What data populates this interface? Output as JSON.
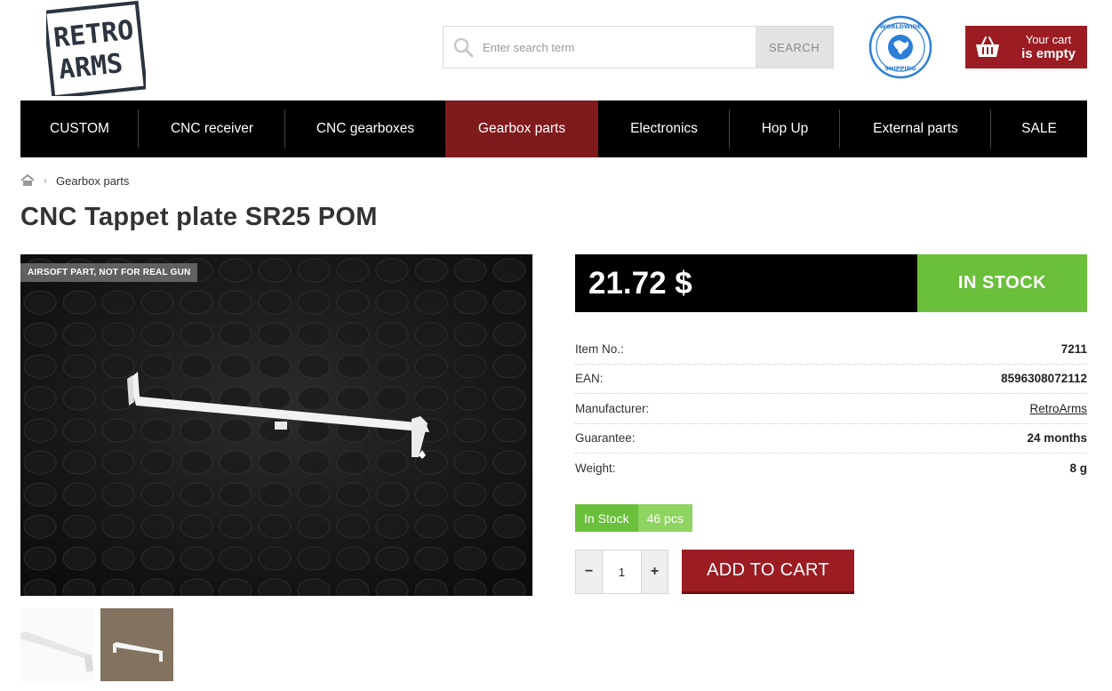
{
  "header": {
    "logo_text": "RETRO ARMS",
    "search": {
      "placeholder": "Enter search term",
      "button_label": "SEARCH"
    },
    "shipping_badge": "WORLDWIDE SHIPPING",
    "cart": {
      "line1": "Your cart",
      "line2": "is empty"
    }
  },
  "nav": {
    "items": [
      {
        "label": "CUSTOM"
      },
      {
        "label": "CNC receiver"
      },
      {
        "label": "CNC gearboxes"
      },
      {
        "label": "Gearbox parts"
      },
      {
        "label": "Electronics"
      },
      {
        "label": "Hop Up"
      },
      {
        "label": "External parts"
      },
      {
        "label": "SALE"
      }
    ]
  },
  "breadcrumb": {
    "current": "Gearbox parts"
  },
  "product": {
    "title": "CNC Tappet plate SR25 POM",
    "image_label": "AIRSOFT PART, NOT FOR REAL GUN",
    "price": "21.72 $",
    "stock_status": "IN STOCK",
    "params": [
      {
        "label": "Item No.:",
        "value": "7211"
      },
      {
        "label": "EAN:",
        "value": "8596308072112"
      },
      {
        "label": "Manufacturer:",
        "value": "RetroArms"
      },
      {
        "label": "Guarantee:",
        "value": "24 months"
      },
      {
        "label": "Weight:",
        "value": "8 g"
      }
    ],
    "availability": {
      "status": "In Stock",
      "quantity": "46 pcs"
    },
    "qty": {
      "minus": "−",
      "value": "1",
      "plus": "+"
    },
    "add_to_cart": "ADD TO CART"
  },
  "colors": {
    "brand_red": "#9b1c22",
    "nav_active": "#7f1a1d",
    "stock_green": "#6abf3b",
    "stock_green_light": "#8ed462",
    "nav_bg": "#000000"
  }
}
